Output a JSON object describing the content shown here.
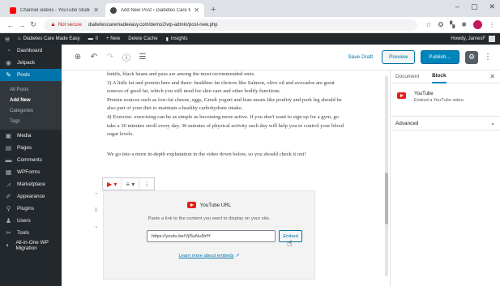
{
  "browser": {
    "tabs": [
      {
        "title": "Channel videos - YouTube Studio",
        "favicon_color": "#ff0000"
      },
      {
        "title": "Add New Post ‹ Diabetes Care M",
        "favicon_color": "#464646"
      }
    ],
    "new_tab_glyph": "+",
    "window_controls": [
      "–",
      "▢",
      "✕"
    ],
    "address": {
      "security_label": "Not secure",
      "url": "diabetescaremadeeasy.com/demo2/wp-admin/post-new.php"
    }
  },
  "admin_bar": {
    "site_name": "Diabetes Care Made Easy",
    "comments_count": "0",
    "new_label": "+ New",
    "delete_cache_label": "Delete Cache",
    "insights_label": "Insights",
    "howdy": "Howdy, JamesF"
  },
  "sidebar": {
    "items": [
      {
        "label": "Dashboard",
        "icon": "dashboard-icon",
        "glyph": "◔"
      },
      {
        "label": "Jetpack",
        "icon": "jetpack-icon",
        "glyph": "◉"
      },
      {
        "label": "Posts",
        "icon": "posts-icon",
        "glyph": "✎",
        "current": true
      },
      {
        "label": "Media",
        "icon": "media-icon",
        "glyph": "▣"
      },
      {
        "label": "Pages",
        "icon": "pages-icon",
        "glyph": "▤"
      },
      {
        "label": "Comments",
        "icon": "comments-icon",
        "glyph": "▬"
      },
      {
        "label": "WPForms",
        "icon": "wpforms-icon",
        "glyph": "▦"
      },
      {
        "label": "Marketplace",
        "icon": "marketplace-icon",
        "glyph": "⩘"
      },
      {
        "label": "Appearance",
        "icon": "appearance-icon",
        "glyph": "✐"
      },
      {
        "label": "Plugins",
        "icon": "plugins-icon",
        "glyph": "⚲"
      },
      {
        "label": "Users",
        "icon": "users-icon",
        "glyph": "♟"
      },
      {
        "label": "Tools",
        "icon": "tools-icon",
        "glyph": "✂"
      },
      {
        "label": "All-in-One WP Migration",
        "icon": "migration-icon",
        "glyph": "◐"
      }
    ],
    "posts_submenu": [
      "All Posts",
      "Add New",
      "Categories",
      "Tags"
    ]
  },
  "editor_toolbar": {
    "save_draft": "Save Draft",
    "preview": "Preview",
    "publish": "Publish…"
  },
  "content": {
    "paragraphs": [
      "lentils, black beans and peas are among the most recommended ones.",
      "3) A little fat and protein here and there: healthier fat choices like Salmon, olive oil and avocados are great sources of good fat, which you still need for skin care and other bodily functions.",
      "Protein sources such as low-fat cheese, eggs, Greek yogurt and lean meats like poultry and pork leg should be also part of your diet to maintain a healthy carbohydrate intake.",
      "4) Exercise: exercising can be as simple as becoming more active. If you don't want to sign up for a gym, go take a 30 minutes stroll every day. 30 minutes of physical activity each day will help you to control your blood sugar levels."
    ],
    "closing": "We go into a more in-depth explanation in the video down below, so you should check it out!"
  },
  "embed": {
    "title": "YouTube URL",
    "instructions": "Paste a link to the content you want to display on your site.",
    "input_value": "https://youtu.be/Vjl5uNuNrfY",
    "button": "Embed",
    "learn_more": "Learn more about embeds"
  },
  "inspector": {
    "tabs": [
      "Document",
      "Block"
    ],
    "active_tab": "Block",
    "block_name": "YouTube",
    "block_desc": "Embed a YouTube video.",
    "advanced": "Advanced"
  }
}
